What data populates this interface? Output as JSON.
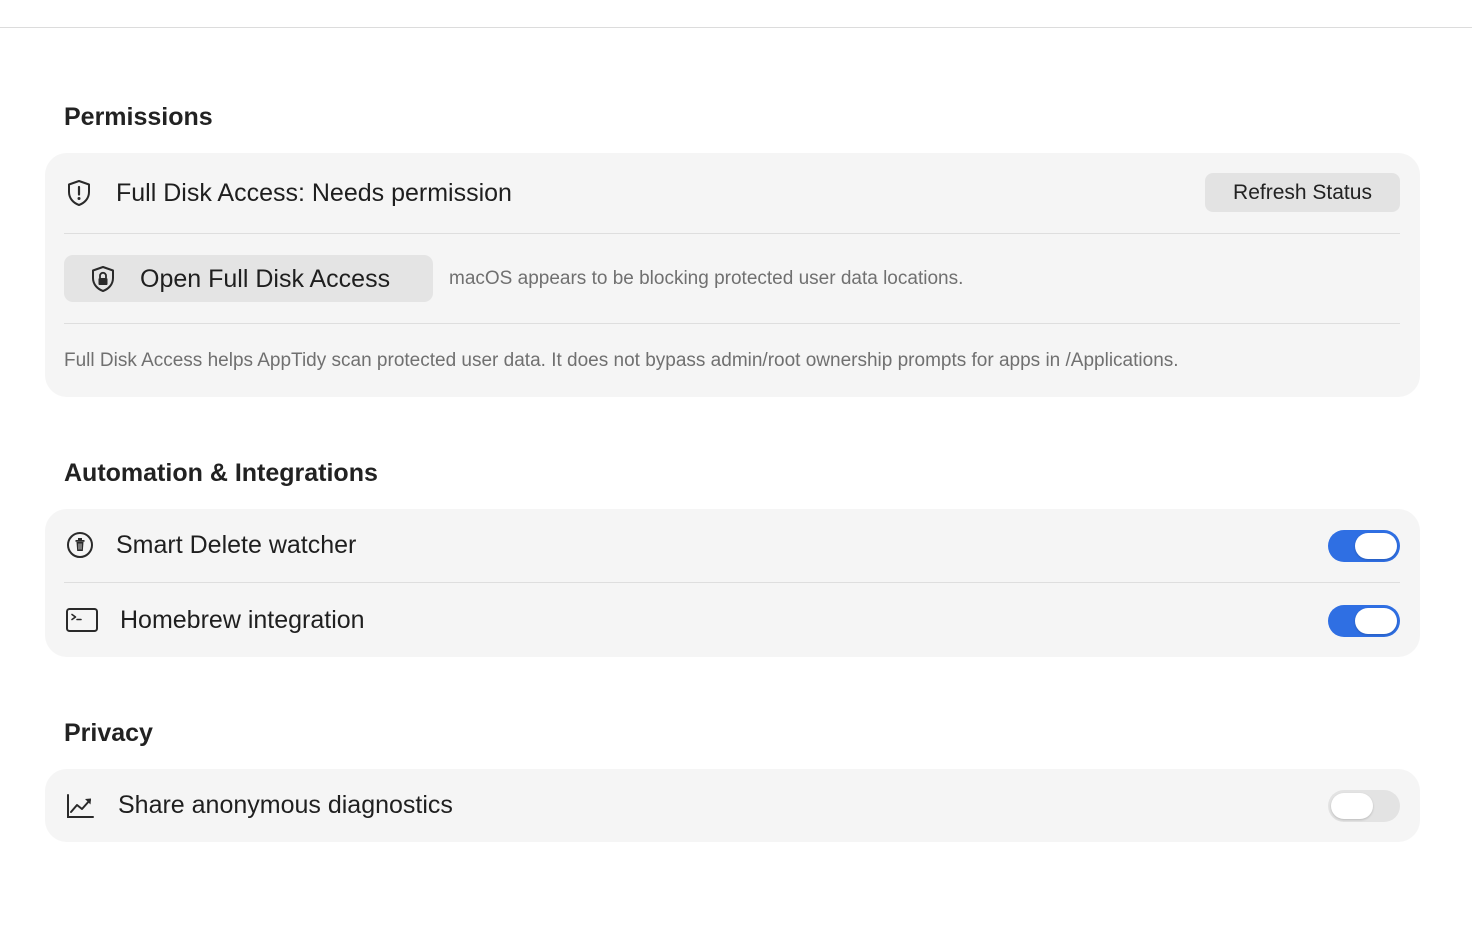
{
  "sections": {
    "permissions": {
      "title": "Permissions",
      "full_disk_status": "Full Disk Access: Needs permission",
      "refresh_label": "Refresh Status",
      "open_label": "Open Full Disk Access",
      "blocking_hint": "macOS appears to be blocking protected user data locations.",
      "info_note": "Full Disk Access helps AppTidy scan protected user data. It does not bypass admin/root ownership prompts for apps in /Applications.",
      "status_icon": "shield-exclamation-icon",
      "open_icon": "shield-lock-icon"
    },
    "automation": {
      "title": "Automation & Integrations",
      "items": [
        {
          "label": "Smart Delete watcher",
          "icon": "trash-circle-icon",
          "enabled": true
        },
        {
          "label": "Homebrew integration",
          "icon": "terminal-icon",
          "enabled": true
        }
      ]
    },
    "privacy": {
      "title": "Privacy",
      "items": [
        {
          "label": "Share anonymous diagnostics",
          "icon": "chart-line-icon",
          "enabled": false
        }
      ]
    }
  },
  "colors": {
    "accent": "#2f6fe3",
    "card_background": "#f5f5f5",
    "toggle_off": "#e3e3e3"
  }
}
